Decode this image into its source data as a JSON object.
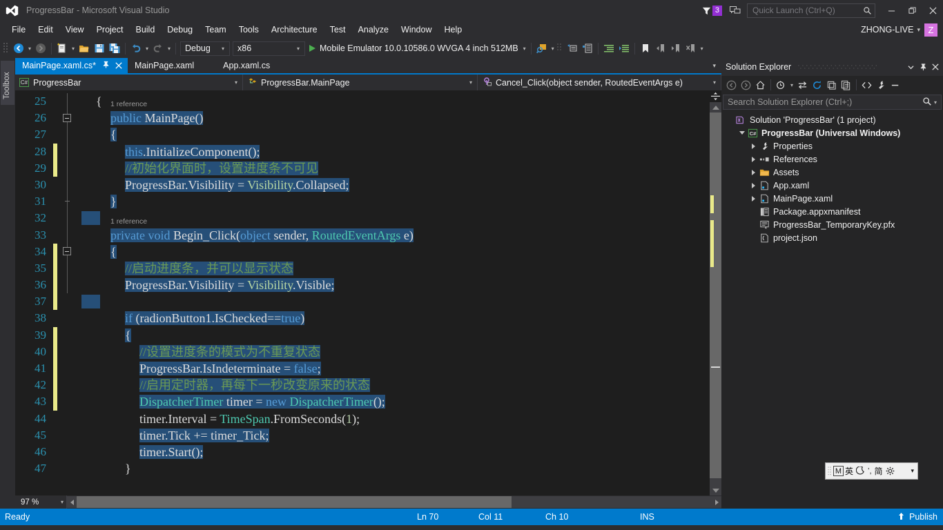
{
  "titlebar": {
    "app_title": "ProgressBar - Microsoft Visual Studio",
    "logo_icon": "visual-studio-logo-icon",
    "notification_icon": "notification-flag-icon",
    "notification_count": "3",
    "feedback_icon": "send-feedback-icon",
    "quick_launch_placeholder": "Quick Launch (Ctrl+Q)",
    "quick_launch_value": "",
    "search_icon": "search-icon",
    "minimize_icon": "minimize-icon",
    "restore_icon": "restore-icon",
    "close_icon": "close-icon"
  },
  "menubar": {
    "items": [
      {
        "label": "File"
      },
      {
        "label": "Edit"
      },
      {
        "label": "View"
      },
      {
        "label": "Project"
      },
      {
        "label": "Build"
      },
      {
        "label": "Debug"
      },
      {
        "label": "Team"
      },
      {
        "label": "Tools"
      },
      {
        "label": "Architecture"
      },
      {
        "label": "Test"
      },
      {
        "label": "Analyze"
      },
      {
        "label": "Window"
      },
      {
        "label": "Help"
      }
    ],
    "user_name": "ZHONG-LIVE",
    "user_caret": "▾",
    "user_avatar_initial": "Z",
    "user_avatar_color": "#d673e0"
  },
  "toolbar": {
    "navigate_back_icon": "navigate-back-icon",
    "navigate_forward_icon": "navigate-forward-icon",
    "new_project_icon": "new-project-icon",
    "open_file_icon": "open-file-icon",
    "save_icon": "save-icon",
    "save_all_icon": "save-all-icon",
    "undo_icon": "undo-icon",
    "redo_icon": "redo-icon",
    "config_value": "Debug",
    "platform_value": "x86",
    "start_icon": "start-debug-play-icon",
    "start_label": "Mobile Emulator 10.0.10586.0 WVGA 4 inch 512MB",
    "find_in_files_icon": "find-in-files-icon",
    "solution_explorer_icon": "solution-explorer-icon",
    "properties_window_icon": "properties-window-icon",
    "toolbox_icon": "toolbox-icon",
    "indent_icon": "indent-icon",
    "outdent_icon": "outdent-icon",
    "bookmark_icon": "bookmark-icon",
    "prev_bookmark_icon": "previous-bookmark-icon",
    "next_bookmark_icon": "next-bookmark-icon",
    "clear_bookmarks_icon": "clear-bookmarks-icon",
    "overflow_caret": "▾",
    "dropdown_caret": "▾"
  },
  "toolbox_strip": {
    "label": "Toolbox"
  },
  "tabstrip": {
    "tabs": [
      {
        "label": "MainPage.xaml.cs*",
        "active": true,
        "pin_icon": "pin-icon",
        "close_icon": "close-icon"
      },
      {
        "label": "MainPage.xaml",
        "active": false
      },
      {
        "label": "App.xaml.cs",
        "active": false
      }
    ],
    "overflow_caret": "▾"
  },
  "navbar": {
    "type_badge": "C#",
    "type_value": "ProgressBar",
    "class_icon": "class-icon",
    "class_value": "ProgressBar.MainPage",
    "member_icon": "method-event-icon",
    "member_value": "Cancel_Click(object sender, RoutedEventArgs e)",
    "caret": "▾"
  },
  "editor": {
    "first_line_number": 25,
    "line_numbers": [
      25,
      26,
      27,
      28,
      29,
      30,
      31,
      32,
      33,
      34,
      35,
      36,
      37,
      38,
      39,
      40,
      41,
      42,
      43,
      44,
      45,
      46,
      47
    ],
    "reference_tags": [
      {
        "text": "1 reference",
        "above_line": 26
      },
      {
        "text": "1 reference",
        "above_line": 33
      }
    ],
    "lines": [
      {
        "n": 25,
        "indent": 1,
        "selected": false,
        "changed": false,
        "tokens": [
          {
            "t": "{",
            "c": "plain"
          }
        ]
      },
      {
        "n": 26,
        "indent": 2,
        "selected": true,
        "changed": false,
        "tokens": [
          {
            "t": "public ",
            "c": "kw"
          },
          {
            "t": "MainPage()",
            "c": "plain"
          }
        ]
      },
      {
        "n": 27,
        "indent": 2,
        "selected": true,
        "changed": false,
        "tokens": [
          {
            "t": "{",
            "c": "plain"
          }
        ]
      },
      {
        "n": 28,
        "indent": 3,
        "selected": true,
        "changed": true,
        "tokens": [
          {
            "t": "this",
            "c": "kw"
          },
          {
            "t": ".InitializeComponent();",
            "c": "plain"
          }
        ]
      },
      {
        "n": 29,
        "indent": 3,
        "selected": true,
        "changed": true,
        "tokens": [
          {
            "t": "//初始化界面时，设置进度条不可见",
            "c": "cmt"
          }
        ]
      },
      {
        "n": 30,
        "indent": 3,
        "selected": true,
        "changed": false,
        "tokens": [
          {
            "t": "ProgressBar.Visibility ",
            "c": "plain"
          },
          {
            "t": "= ",
            "c": "plain"
          },
          {
            "t": "Visibility",
            "c": "enumv"
          },
          {
            "t": ".Collapsed;",
            "c": "plain"
          }
        ]
      },
      {
        "n": 31,
        "indent": 2,
        "selected": true,
        "changed": false,
        "tokens": [
          {
            "t": "}",
            "c": "plain"
          }
        ]
      },
      {
        "n": 32,
        "indent": 0,
        "selected": true,
        "changed": false,
        "tokens": []
      },
      {
        "n": 33,
        "indent": 2,
        "selected": true,
        "changed": false,
        "tokens": [
          {
            "t": "private void ",
            "c": "kw"
          },
          {
            "t": "Begin_Click(",
            "c": "plain"
          },
          {
            "t": "object ",
            "c": "kw"
          },
          {
            "t": "sender, ",
            "c": "plain"
          },
          {
            "t": "RoutedEventArgs ",
            "c": "type"
          },
          {
            "t": "e)",
            "c": "plain"
          }
        ]
      },
      {
        "n": 34,
        "indent": 2,
        "selected": true,
        "changed": true,
        "tokens": [
          {
            "t": "{",
            "c": "plain"
          }
        ]
      },
      {
        "n": 35,
        "indent": 3,
        "selected": true,
        "changed": true,
        "tokens": [
          {
            "t": "//启动进度条，并可以显示状态",
            "c": "cmt"
          }
        ]
      },
      {
        "n": 36,
        "indent": 3,
        "selected": true,
        "changed": true,
        "tokens": [
          {
            "t": "ProgressBar.Visibility ",
            "c": "plain"
          },
          {
            "t": "= ",
            "c": "plain"
          },
          {
            "t": "Visibility",
            "c": "enumv"
          },
          {
            "t": ".Visible;",
            "c": "plain"
          }
        ]
      },
      {
        "n": 37,
        "indent": 0,
        "selected": true,
        "changed": true,
        "tokens": []
      },
      {
        "n": 38,
        "indent": 3,
        "selected": true,
        "changed": false,
        "tokens": [
          {
            "t": "if ",
            "c": "ctrl"
          },
          {
            "t": "(radionButton1.IsChecked==",
            "c": "plain"
          },
          {
            "t": "true",
            "c": "kw"
          },
          {
            "t": ")",
            "c": "plain"
          }
        ]
      },
      {
        "n": 39,
        "indent": 3,
        "selected": true,
        "changed": true,
        "tokens": [
          {
            "t": "{",
            "c": "plain"
          }
        ]
      },
      {
        "n": 40,
        "indent": 4,
        "selected": true,
        "changed": true,
        "tokens": [
          {
            "t": "//设置进度条的模式为不重复状态",
            "c": "cmt"
          }
        ]
      },
      {
        "n": 41,
        "indent": 4,
        "selected": true,
        "changed": true,
        "tokens": [
          {
            "t": "ProgressBar.IsIndeterminate ",
            "c": "plain"
          },
          {
            "t": "= ",
            "c": "plain"
          },
          {
            "t": "false",
            "c": "kw"
          },
          {
            "t": ";",
            "c": "plain"
          }
        ]
      },
      {
        "n": 42,
        "indent": 4,
        "selected": true,
        "changed": true,
        "tokens": [
          {
            "t": "//启用定时器，再每下一秒改变原来的状态",
            "c": "cmt"
          }
        ]
      },
      {
        "n": 43,
        "indent": 4,
        "selected": true,
        "changed": true,
        "tokens": [
          {
            "t": "DispatcherTimer ",
            "c": "type"
          },
          {
            "t": "timer ",
            "c": "plain"
          },
          {
            "t": "= ",
            "c": "plain"
          },
          {
            "t": "new ",
            "c": "kw"
          },
          {
            "t": "DispatcherTimer",
            "c": "type"
          },
          {
            "t": "();",
            "c": "plain"
          }
        ]
      },
      {
        "n": 44,
        "indent": 4,
        "selected": false,
        "changed": false,
        "tokens": [
          {
            "t": "timer.Interval ",
            "c": "plain"
          },
          {
            "t": "= ",
            "c": "plain"
          },
          {
            "t": "TimeSpan",
            "c": "type"
          },
          {
            "t": ".FromSeconds(",
            "c": "plain"
          },
          {
            "t": "1",
            "c": "num"
          },
          {
            "t": ");",
            "c": "plain"
          }
        ]
      },
      {
        "n": 45,
        "indent": 4,
        "selected": true,
        "changed": false,
        "tokens": [
          {
            "t": "timer.Tick ",
            "c": "plain"
          },
          {
            "t": "+= ",
            "c": "plain"
          },
          {
            "t": "timer_Tick;",
            "c": "plain"
          }
        ]
      },
      {
        "n": 46,
        "indent": 4,
        "selected": true,
        "changed": false,
        "tokens": [
          {
            "t": "timer.Start();",
            "c": "plain"
          }
        ]
      },
      {
        "n": 47,
        "indent": 3,
        "selected": false,
        "changed": false,
        "tokens": [
          {
            "t": "}",
            "c": "plain"
          }
        ]
      }
    ],
    "zoom_level": "97 %",
    "zoom_caret": "▾"
  },
  "solution_explorer": {
    "title": "Solution Explorer",
    "header_caret_icon": "chevron-down-icon",
    "pin_icon": "pin-icon",
    "close_icon": "close-icon",
    "toolbar_icons": [
      "navigate-back-icon",
      "navigate-forward-icon",
      "home-icon",
      "pending-changes-icon",
      "sync-with-active-document-icon",
      "refresh-icon",
      "collapse-all-icon",
      "show-all-files-icon",
      "view-code-icon",
      "properties-icon",
      "preview-selected-items-icon"
    ],
    "search_placeholder": "Search Solution Explorer (Ctrl+;)",
    "search_value": "",
    "search_icon": "search-icon",
    "search_caret": "▾",
    "tree": [
      {
        "label": "Solution 'ProgressBar' (1 project)",
        "depth": 0,
        "arrow": "none",
        "icon": "solution-icon",
        "bold": false
      },
      {
        "label": "ProgressBar (Universal Windows)",
        "depth": 1,
        "arrow": "open",
        "icon": "csharp-project-icon",
        "bold": true
      },
      {
        "label": "Properties",
        "depth": 2,
        "arrow": "closed",
        "icon": "wrench-icon",
        "bold": false
      },
      {
        "label": "References",
        "depth": 2,
        "arrow": "closed",
        "icon": "references-icon",
        "bold": false
      },
      {
        "label": "Assets",
        "depth": 2,
        "arrow": "closed",
        "icon": "folder-icon",
        "bold": false
      },
      {
        "label": "App.xaml",
        "depth": 2,
        "arrow": "closed",
        "icon": "xaml-file-icon",
        "bold": false
      },
      {
        "label": "MainPage.xaml",
        "depth": 2,
        "arrow": "closed",
        "icon": "xaml-file-icon",
        "bold": false
      },
      {
        "label": "Package.appxmanifest",
        "depth": 2,
        "arrow": "none",
        "icon": "manifest-file-icon",
        "bold": false
      },
      {
        "label": "ProgressBar_TemporaryKey.pfx",
        "depth": 2,
        "arrow": "none",
        "icon": "certificate-file-icon",
        "bold": false
      },
      {
        "label": "project.json",
        "depth": 2,
        "arrow": "none",
        "icon": "json-file-icon",
        "bold": false
      }
    ]
  },
  "ime_bar": {
    "mode_label": "M",
    "ime_name_icon": "chinese-ime-icon",
    "moon_icon": "moon-icon",
    "punctuation_icon": "punctuation-icon",
    "simplified_label": "简",
    "settings_icon": "gear-icon",
    "expand_icon": "chevron-down-icon"
  },
  "statusbar": {
    "ready_text": "Ready",
    "line": "Ln 70",
    "col": "Col 11",
    "ch": "Ch 10",
    "insert_mode": "INS",
    "publish_label": "Publish",
    "publish_icon": "upload-arrow-icon",
    "background_color": "#007acc"
  }
}
